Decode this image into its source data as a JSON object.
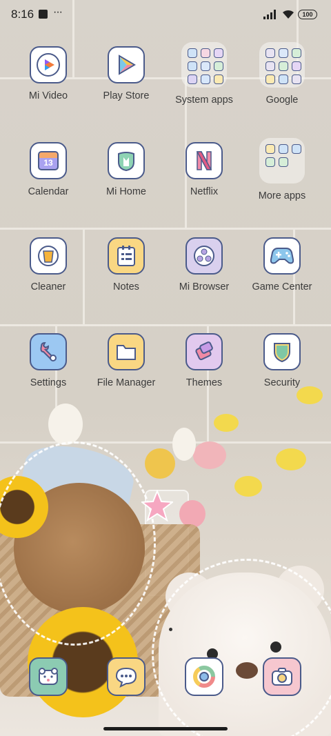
{
  "status_bar": {
    "time": "8:16",
    "more": "···",
    "battery": "100"
  },
  "apps": [
    {
      "label": "Mi Video",
      "icon": "mi-video-icon"
    },
    {
      "label": "Play Store",
      "icon": "play-store-icon"
    },
    {
      "label": "System apps",
      "icon": "folder-icon"
    },
    {
      "label": "Google",
      "icon": "folder-icon"
    },
    {
      "label": "Calendar",
      "icon": "calendar-icon",
      "calendar_day": "13"
    },
    {
      "label": "Mi Home",
      "icon": "mi-home-icon"
    },
    {
      "label": "Netflix",
      "icon": "netflix-icon"
    },
    {
      "label": "More apps",
      "icon": "folder-icon"
    },
    {
      "label": "Cleaner",
      "icon": "cleaner-icon"
    },
    {
      "label": "Notes",
      "icon": "notes-icon"
    },
    {
      "label": "Mi Browser",
      "icon": "browser-icon"
    },
    {
      "label": "Game Center",
      "icon": "gamepad-icon"
    },
    {
      "label": "Settings",
      "icon": "wrench-icon"
    },
    {
      "label": "File Manager",
      "icon": "file-folder-icon"
    },
    {
      "label": "Themes",
      "icon": "themes-icon"
    },
    {
      "label": "Security",
      "icon": "shield-icon"
    }
  ],
  "dock": [
    {
      "name": "gallery",
      "icon": "bear-gallery-icon"
    },
    {
      "name": "messages",
      "icon": "message-bubble-icon"
    },
    {
      "name": "chrome",
      "icon": "chrome-icon"
    },
    {
      "name": "camera",
      "icon": "camera-icon"
    }
  ],
  "colors": {
    "icon_border": "#4a5a8a",
    "label": "#3b3b3b"
  }
}
